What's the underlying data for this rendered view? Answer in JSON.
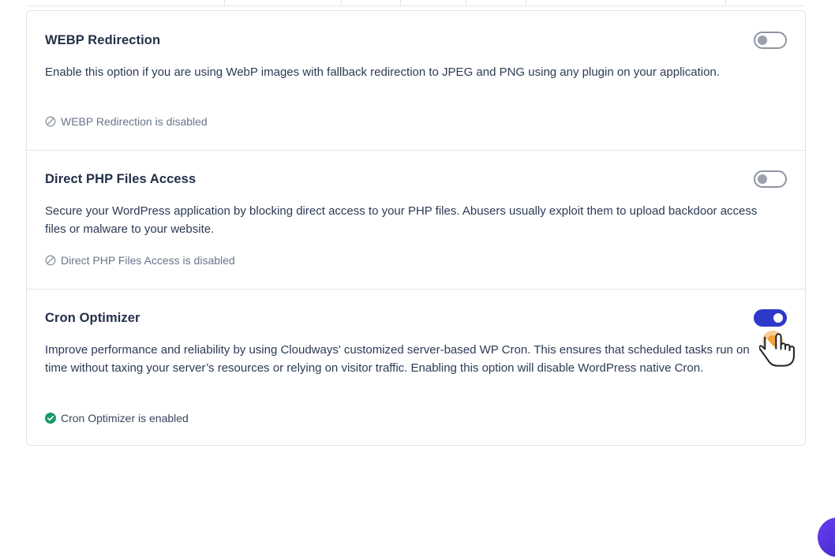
{
  "sections": [
    {
      "title": "WEBP Redirection",
      "description": "Enable this option if you are using WebP images with fallback redirection to JPEG and PNG using any plugin on your application.",
      "status": "WEBP Redirection is disabled",
      "enabled": false
    },
    {
      "title": "Direct PHP Files Access",
      "description": "Secure your WordPress application by blocking direct access to your PHP files. Abusers usually exploit them to upload backdoor access files or malware to your website.",
      "status": "Direct PHP Files Access is disabled",
      "enabled": false
    },
    {
      "title": "Cron Optimizer",
      "description": "Improve performance and reliability by using Cloudways' customized server-based WP Cron. This ensures that scheduled tasks run on time without taxing your server’s resources or relying on visitor traffic. Enabling this option will disable WordPress native Cron.",
      "status": "Cron Optimizer is enabled",
      "enabled": true
    }
  ],
  "colors": {
    "accent": "#2e38c9",
    "enabled_check": "#1a9a6a",
    "disabled_icon": "#8e95a2",
    "cursor_highlight": "#f2a33a"
  },
  "icons": {
    "disabled": "ban-icon",
    "enabled": "check-circle-icon",
    "cursor": "hand-pointer-icon",
    "chat": "chat-launcher-icon"
  }
}
